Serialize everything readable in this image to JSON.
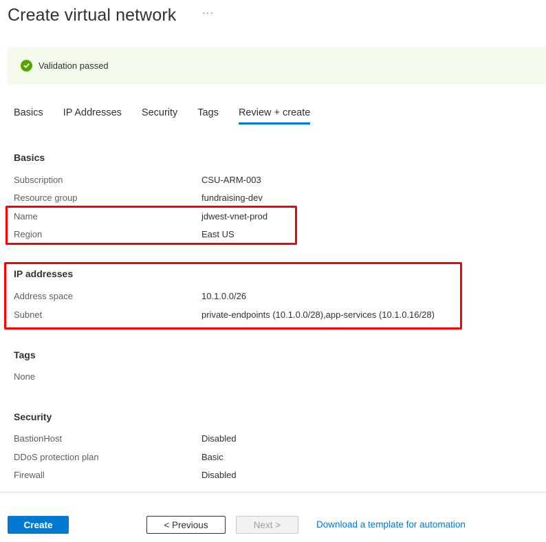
{
  "header": {
    "title": "Create virtual network",
    "more_label": "···"
  },
  "validation": {
    "icon": "check-circle-icon",
    "text": "Validation passed",
    "status_color": "#57a300"
  },
  "tabs": [
    {
      "label": "Basics",
      "active": false
    },
    {
      "label": "IP Addresses",
      "active": false
    },
    {
      "label": "Security",
      "active": false
    },
    {
      "label": "Tags",
      "active": false
    },
    {
      "label": "Review + create",
      "active": true
    }
  ],
  "sections": {
    "basics": {
      "heading": "Basics",
      "rows": [
        {
          "label": "Subscription",
          "value": "CSU-ARM-003"
        },
        {
          "label": "Resource group",
          "value": "fundraising-dev"
        },
        {
          "label": "Name",
          "value": "jdwest-vnet-prod"
        },
        {
          "label": "Region",
          "value": "East US"
        }
      ]
    },
    "ip_addresses": {
      "heading": "IP addresses",
      "rows": [
        {
          "label": "Address space",
          "value": "10.1.0.0/26"
        },
        {
          "label": "Subnet",
          "value": "private-endpoints (10.1.0.0/28),app-services (10.1.0.16/28)"
        }
      ]
    },
    "tags": {
      "heading": "Tags",
      "value": "None"
    },
    "security": {
      "heading": "Security",
      "rows": [
        {
          "label": "BastionHost",
          "value": "Disabled"
        },
        {
          "label": "DDoS protection plan",
          "value": "Basic"
        },
        {
          "label": "Firewall",
          "value": "Disabled"
        }
      ]
    }
  },
  "annotation_color": "#ff0000",
  "footer": {
    "create_label": "Create",
    "previous_label": "< Previous",
    "next_label": "Next >",
    "next_disabled": true,
    "download_link": "Download a template for automation",
    "accent_color": "#0078d4"
  }
}
